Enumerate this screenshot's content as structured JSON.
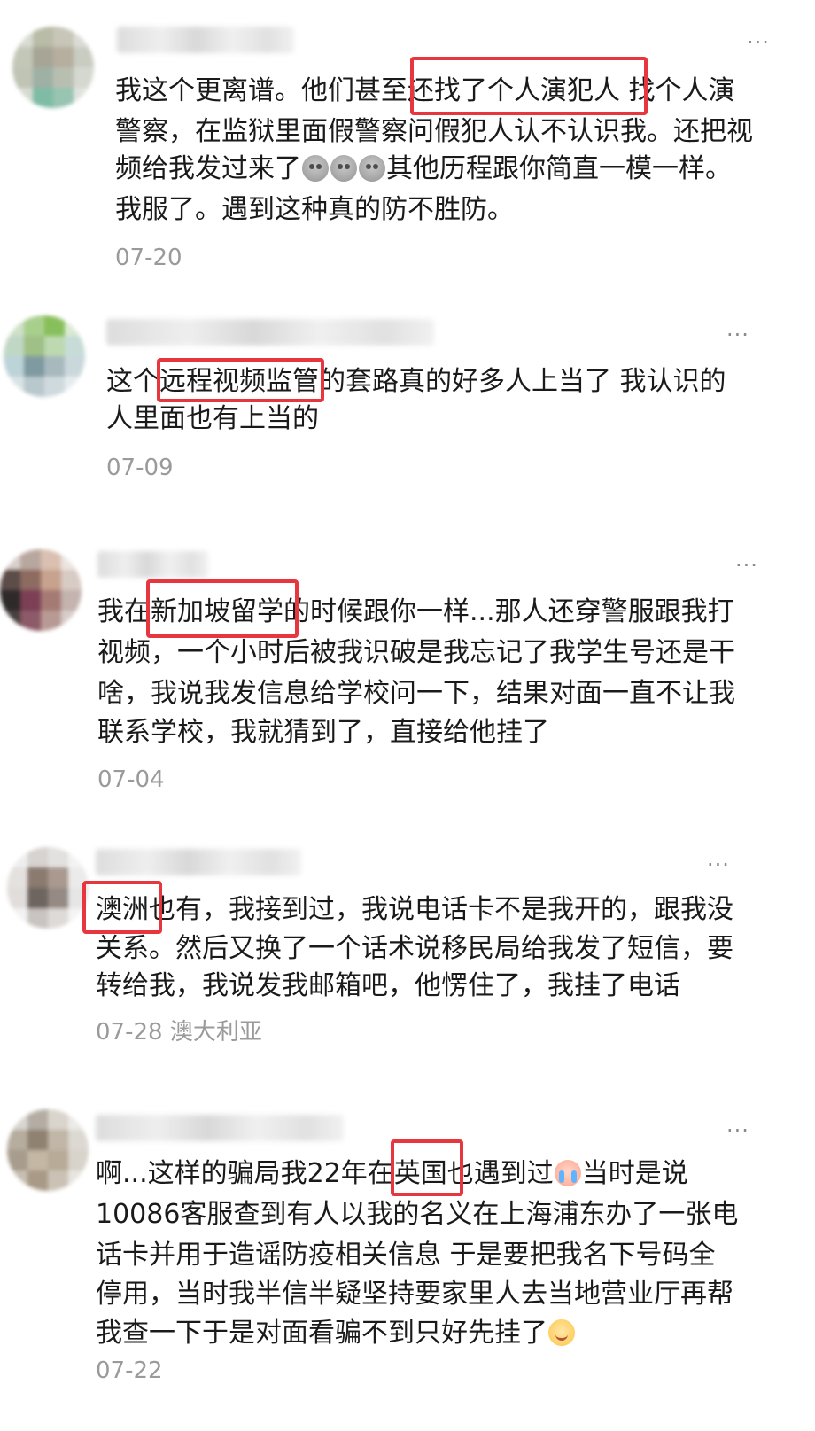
{
  "more_glyph": "···",
  "comments": [
    {
      "lines": [
        "我这个更离谱。他们甚至还找了个人演犯人    找个人演",
        "警察，在监狱里面假警察问假犯人认不认识我。还把视",
        "频给我发过来了",
        "我服了。遇到这种真的防不胜防。"
      ],
      "line3_after": "其他历程跟你简直一模一样。",
      "date": "07-20",
      "location": ""
    },
    {
      "lines": [
        "这个远程视频监管的套路真的好多人上当了 我认识的",
        "人里面也有上当的"
      ],
      "date": "07-09",
      "location": ""
    },
    {
      "lines": [
        "我在新加坡留学的时候跟你一样...那人还穿警服跟我打",
        "视频，一个小时后被我识破是我忘记了我学生号还是干",
        "啥，我说我发信息给学校问一下，结果对面一直不让我",
        "联系学校，我就猜到了，直接给他挂了"
      ],
      "date": "07-04",
      "location": ""
    },
    {
      "lines": [
        "澳洲也有，我接到过，我说电话卡不是我开的，跟我没",
        "关系。然后又换了一个话术说移民局给我发了短信，要",
        "转给我，我说发我邮箱吧，他愣住了，我挂了电话"
      ],
      "date": "07-28",
      "location": "澳大利亚"
    },
    {
      "lines": [
        "啊...这样的骗局我22年在英国也遇到过",
        "10086客服查到有人以我的名义在上海浦东办了一张电",
        "话卡并用于造谣防疫相关信息 于是要把我名下号码全",
        "停用，当时我半信半疑坚持要家里人去当地营业厅再帮",
        "我查一下于是对面看骗不到只好先挂了"
      ],
      "line1_after": "当时是说",
      "date": "07-22",
      "location": ""
    }
  ],
  "icons": {
    "emoji_1": "weary-face-icon",
    "emoji_2": "crying-face-icon",
    "emoji_3": "smiling-face-icon"
  },
  "colors": {
    "highlight": "#e8363e",
    "text": "#1a1a1a",
    "meta": "#9a9a9a",
    "more": "#8a8a8a"
  }
}
